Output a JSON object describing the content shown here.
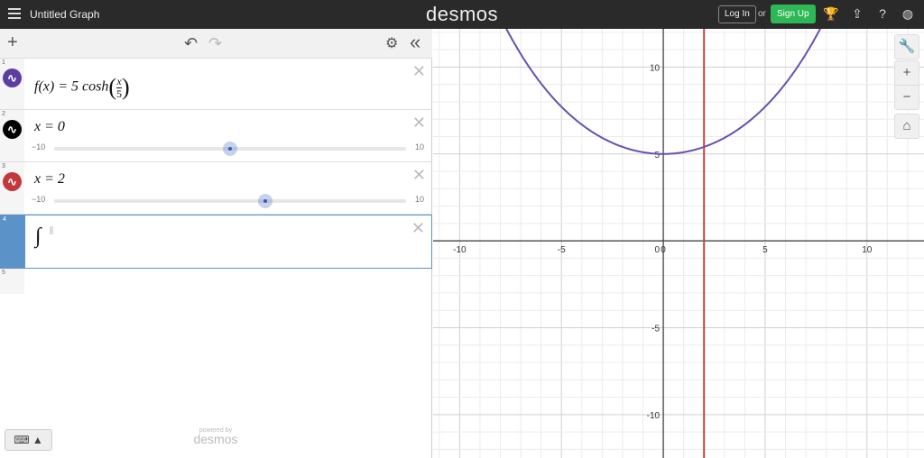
{
  "header": {
    "title": "Untitled Graph",
    "logo": "desmos",
    "login": "Log In",
    "or": "or",
    "signup": "Sign Up",
    "icons": [
      "trophy-icon",
      "share-icon",
      "help-icon",
      "globe-icon"
    ]
  },
  "toolbar": {
    "add": "+",
    "undo": "↶",
    "redo": "↷",
    "settings": "⚙",
    "collapse": "«"
  },
  "expressions": [
    {
      "num": "1",
      "color": "#5b3fa0",
      "latex": "f(x) = 5 cosh(x/5)",
      "parts": {
        "lhs": "f(x) = 5 cosh",
        "numer": "x",
        "denom": "5"
      }
    },
    {
      "num": "2",
      "color": "#000000",
      "text": "x = 0",
      "slider": {
        "min": "−10",
        "max": "10",
        "value": 0
      }
    },
    {
      "num": "3",
      "color": "#c0393b",
      "text": "x = 2",
      "slider": {
        "min": "−10",
        "max": "10",
        "value": 2
      }
    },
    {
      "num": "4",
      "color": "#5b93c8",
      "text": "∫"
    },
    {
      "num": "5"
    }
  ],
  "footer": {
    "powered": "powered by",
    "brand": "desmos",
    "keyboard": "⌨ ▲"
  },
  "graph_controls": {
    "wrench": "🔧",
    "zoom_in": "+",
    "zoom_out": "−",
    "home": "⌂"
  },
  "chart_data": {
    "type": "line",
    "xlim": [
      -11.3,
      12.8
    ],
    "ylim": [
      -12.5,
      12.2
    ],
    "xticks": [
      -10,
      -5,
      0,
      5,
      10
    ],
    "yticks": [
      -10,
      -5,
      5,
      10
    ],
    "grid": true,
    "series": [
      {
        "name": "f(x)=5cosh(x/5)",
        "color": "#6a4fb0"
      },
      {
        "name": "x=2",
        "color": "#c74440",
        "vertical": 2
      }
    ]
  }
}
